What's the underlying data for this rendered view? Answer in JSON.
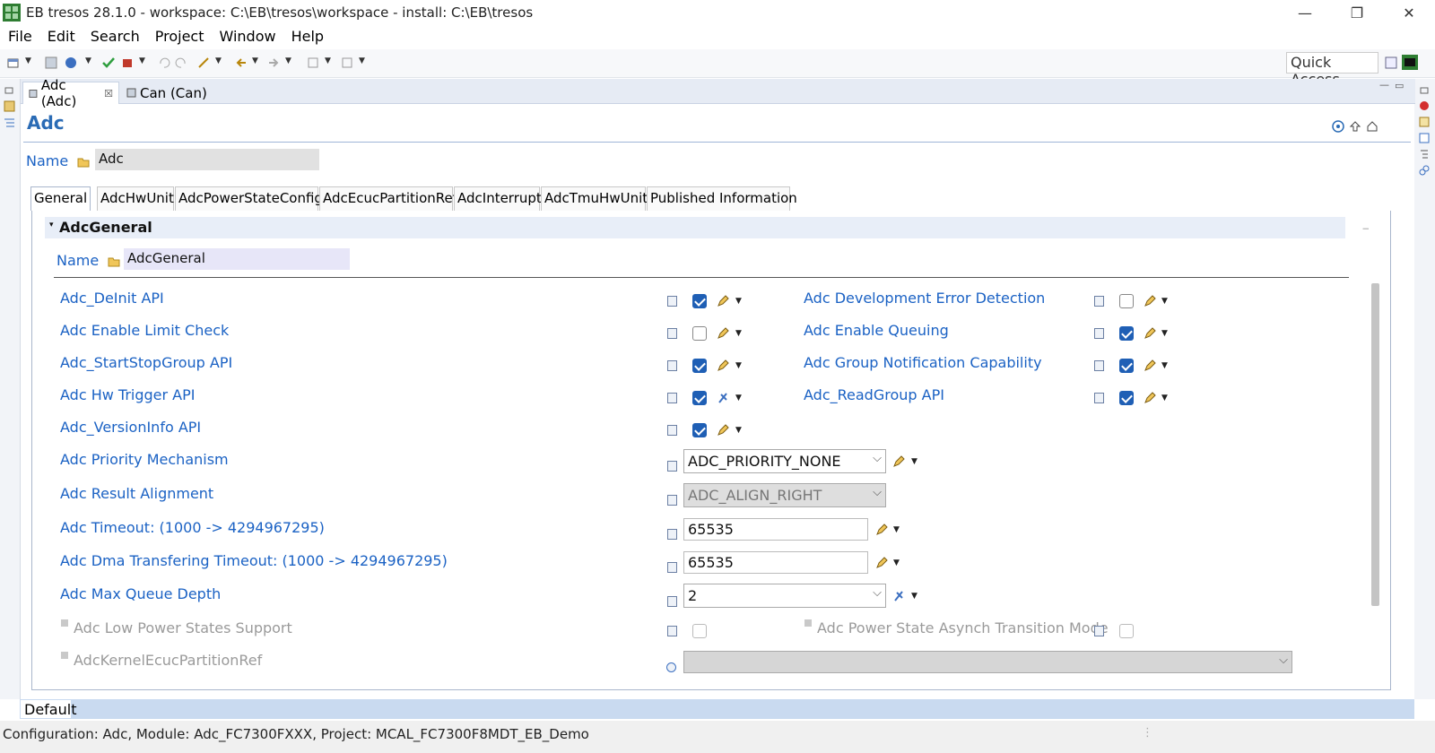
{
  "window": {
    "title": "EB tresos 28.1.0 - workspace: C:\\EB\\tresos\\workspace - install: C:\\EB\\tresos",
    "minimize": "—",
    "restore": "❐",
    "close": "✕"
  },
  "menu": [
    "File",
    "Edit",
    "Search",
    "Project",
    "Window",
    "Help"
  ],
  "toolbar": {
    "quick_access": "Quick Access"
  },
  "editor_tabs": [
    {
      "label": "Adc (Adc)",
      "close": "☒"
    },
    {
      "label": "Can (Can)"
    }
  ],
  "form": {
    "title": "Adc",
    "name_label": "Name",
    "name_value": "Adc"
  },
  "page_tabs": [
    "General",
    "AdcHwUnit",
    "AdcPowerStateConfig",
    "AdcEcucPartitionRef",
    "AdcInterrupt",
    "AdcTmuHwUnit",
    "Published Information"
  ],
  "section": {
    "title": "AdcGeneral",
    "name_label": "Name",
    "name_value": "AdcGeneral"
  },
  "fields": {
    "deinit": {
      "label": "Adc_DeInit API",
      "checked": true
    },
    "dev_error": {
      "label": "Adc Development Error Detection",
      "checked": false
    },
    "limit_check": {
      "label": "Adc Enable Limit Check",
      "checked": false
    },
    "queuing": {
      "label": "Adc Enable Queuing",
      "checked": true
    },
    "startstop": {
      "label": "Adc_StartStopGroup API",
      "checked": true
    },
    "group_notif": {
      "label": "Adc Group Notification Capability",
      "checked": true
    },
    "hw_trigger": {
      "label": "Adc Hw Trigger  API",
      "checked": true
    },
    "readgroup": {
      "label": "Adc_ReadGroup API",
      "checked": true
    },
    "versioninfo": {
      "label": "Adc_VersionInfo API",
      "checked": true
    },
    "priority": {
      "label": "Adc Priority Mechanism",
      "value": "ADC_PRIORITY_NONE"
    },
    "alignment": {
      "label": "Adc Result Alignment",
      "value": "ADC_ALIGN_RIGHT"
    },
    "timeout": {
      "label": "Adc Timeout: (1000 -> 4294967295)",
      "value": "65535"
    },
    "dma_timeout": {
      "label": "Adc Dma Transfering Timeout: (1000 -> 4294967295)",
      "value": "65535"
    },
    "max_queue": {
      "label": "Adc Max Queue Depth",
      "value": "2"
    },
    "low_power": {
      "label": "Adc Low Power States Support",
      "checked": false
    },
    "power_async": {
      "label": "Adc Power State Asynch Transition Mode",
      "checked": false
    },
    "kernel_ref": {
      "label": "AdcKernelEcucPartitionRef",
      "value": ""
    }
  },
  "bottom_tab": "Default",
  "status": "Configuration: Adc, Module: Adc_FC7300FXXX, Project: MCAL_FC7300F8MDT_EB_Demo"
}
